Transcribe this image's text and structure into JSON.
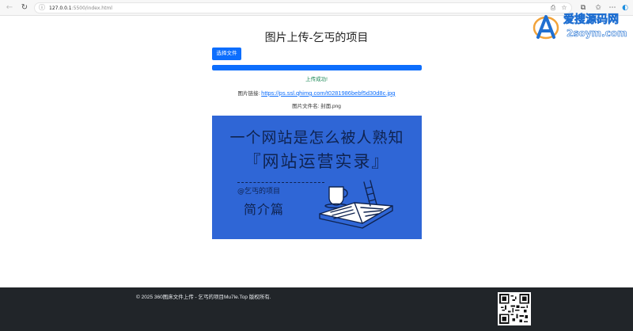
{
  "browser": {
    "address_host": "127.0.0.1",
    "address_path": ":5500/index.html",
    "icons": [
      "back-icon",
      "reload-icon",
      "info-icon",
      "share-icon",
      "star-icon",
      "extensions-icon",
      "favorites-icon",
      "more-icon",
      "edge-icon"
    ]
  },
  "main": {
    "title": "图片上传-乞丐的项目",
    "choose_button": "选择文件",
    "progress_percent": 100,
    "status": "上传成功!",
    "link_label": "图片链接: ",
    "link_url": "https://ps.ssl.qhimg.com/t0281986bebf5d30d8c.jpg",
    "filename_label": "图片文件名: ",
    "filename": "封面.png"
  },
  "preview": {
    "line1": "一个网站是怎么被人熟知",
    "line2": "『网站运营实录』",
    "author": "@乞丐的项目",
    "subtitle": "简介篇",
    "bg_color": "#2f66d6",
    "ink_color": "#0f2350"
  },
  "footer": {
    "copyright": "© 2025 360图床文件上传 - 乞丐的项目Mu7le.Top 版权所有.",
    "bg_color": "#212529"
  },
  "watermark": {
    "line1": "爱搜源码网",
    "line2": "2soym.com"
  },
  "colors": {
    "accent": "#0d6efd",
    "success": "#198754"
  }
}
